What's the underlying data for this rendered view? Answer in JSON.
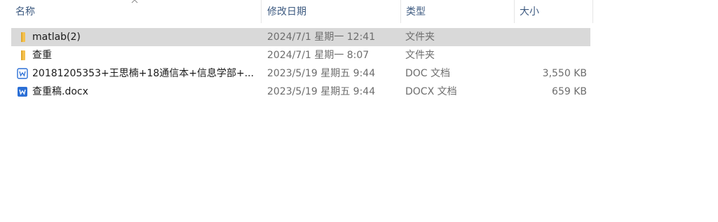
{
  "columns": {
    "name": "名称",
    "date": "修改日期",
    "type": "类型",
    "size": "大小"
  },
  "files": [
    {
      "name": "matlab(2)",
      "date": "2024/7/1 星期一 12:41",
      "type": "文件夹",
      "size": "",
      "icon": "folder-icon",
      "selected": true
    },
    {
      "name": "查重",
      "date": "2024/7/1 星期一 8:07",
      "type": "文件夹",
      "size": "",
      "icon": "folder-icon",
      "selected": false
    },
    {
      "name": "20181205353+王思楠+18通信本+信息学部+...",
      "date": "2023/5/19 星期五 9:44",
      "type": "DOC 文档",
      "size": "3,550 KB",
      "icon": "word-doc-icon",
      "selected": false
    },
    {
      "name": "查重稿.docx",
      "date": "2023/5/19 星期五 9:44",
      "type": "DOCX 文档",
      "size": "659 KB",
      "icon": "word-docx-icon",
      "selected": false
    }
  ],
  "colors": {
    "header_text": "#3d5a80",
    "selected_row": "#d9d9d9",
    "folder": "#f4c04e",
    "word_blue": "#2b6fd6"
  }
}
